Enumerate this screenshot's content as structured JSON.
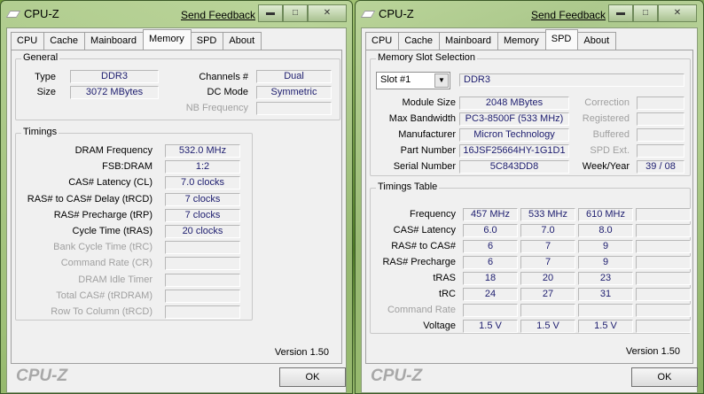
{
  "left": {
    "title": "CPU-Z",
    "feedback": "Send Feedback",
    "tabs": [
      "CPU",
      "Cache",
      "Mainboard",
      "Memory",
      "SPD",
      "About"
    ],
    "active_tab": "Memory",
    "general": {
      "title": "General",
      "type_label": "Type",
      "type": "DDR3",
      "size_label": "Size",
      "size": "3072 MBytes",
      "channels_label": "Channels #",
      "channels": "Dual",
      "dcmode_label": "DC Mode",
      "dcmode": "Symmetric",
      "nb_label": "NB Frequency",
      "nb": ""
    },
    "timings": {
      "title": "Timings",
      "rows": [
        {
          "label": "DRAM Frequency",
          "value": "532.0 MHz",
          "dim": false
        },
        {
          "label": "FSB:DRAM",
          "value": "1:2",
          "dim": false
        },
        {
          "label": "CAS# Latency (CL)",
          "value": "7.0 clocks",
          "dim": false
        },
        {
          "label": "RAS# to CAS# Delay (tRCD)",
          "value": "7 clocks",
          "dim": false
        },
        {
          "label": "RAS# Precharge (tRP)",
          "value": "7 clocks",
          "dim": false
        },
        {
          "label": "Cycle Time (tRAS)",
          "value": "20 clocks",
          "dim": false
        },
        {
          "label": "Bank Cycle Time (tRC)",
          "value": "",
          "dim": true
        },
        {
          "label": "Command Rate (CR)",
          "value": "",
          "dim": true
        },
        {
          "label": "DRAM Idle Timer",
          "value": "",
          "dim": true
        },
        {
          "label": "Total CAS# (tRDRAM)",
          "value": "",
          "dim": true
        },
        {
          "label": "Row To Column (tRCD)",
          "value": "",
          "dim": true
        }
      ]
    },
    "version": "Version 1.50",
    "logo": "CPU-Z",
    "ok": "OK"
  },
  "right": {
    "title": "CPU-Z",
    "feedback": "Send Feedback",
    "tabs": [
      "CPU",
      "Cache",
      "Mainboard",
      "Memory",
      "SPD",
      "About"
    ],
    "active_tab": "SPD",
    "slot": {
      "title": "Memory Slot Selection",
      "selected": "Slot #1",
      "type": "DDR3",
      "rows": [
        {
          "label": "Module Size",
          "value": "2048 MBytes",
          "rlabel": "Correction",
          "rvalue": ""
        },
        {
          "label": "Max Bandwidth",
          "value": "PC3-8500F (533 MHz)",
          "rlabel": "Registered",
          "rvalue": ""
        },
        {
          "label": "Manufacturer",
          "value": "Micron Technology",
          "rlabel": "Buffered",
          "rvalue": ""
        },
        {
          "label": "Part Number",
          "value": "16JSF25664HY-1G1D1",
          "rlabel": "SPD Ext.",
          "rvalue": ""
        },
        {
          "label": "Serial Number",
          "value": "5C843DD8",
          "rlabel": "Week/Year",
          "rvalue": "39 / 08",
          "rdark": true
        }
      ]
    },
    "table": {
      "title": "Timings Table",
      "rows": [
        {
          "label": "Frequency",
          "values": [
            "457 MHz",
            "533 MHz",
            "610 MHz",
            ""
          ]
        },
        {
          "label": "CAS# Latency",
          "values": [
            "6.0",
            "7.0",
            "8.0",
            ""
          ]
        },
        {
          "label": "RAS# to CAS#",
          "values": [
            "6",
            "7",
            "9",
            ""
          ]
        },
        {
          "label": "RAS# Precharge",
          "values": [
            "6",
            "7",
            "9",
            ""
          ]
        },
        {
          "label": "tRAS",
          "values": [
            "18",
            "20",
            "23",
            ""
          ]
        },
        {
          "label": "tRC",
          "values": [
            "24",
            "27",
            "31",
            ""
          ]
        },
        {
          "label": "Command Rate",
          "values": [
            "",
            "",
            "",
            ""
          ],
          "dim": true
        },
        {
          "label": "Voltage",
          "values": [
            "1.5 V",
            "1.5 V",
            "1.5 V",
            ""
          ]
        }
      ]
    },
    "version": "Version 1.50",
    "logo": "CPU-Z",
    "ok": "OK"
  }
}
